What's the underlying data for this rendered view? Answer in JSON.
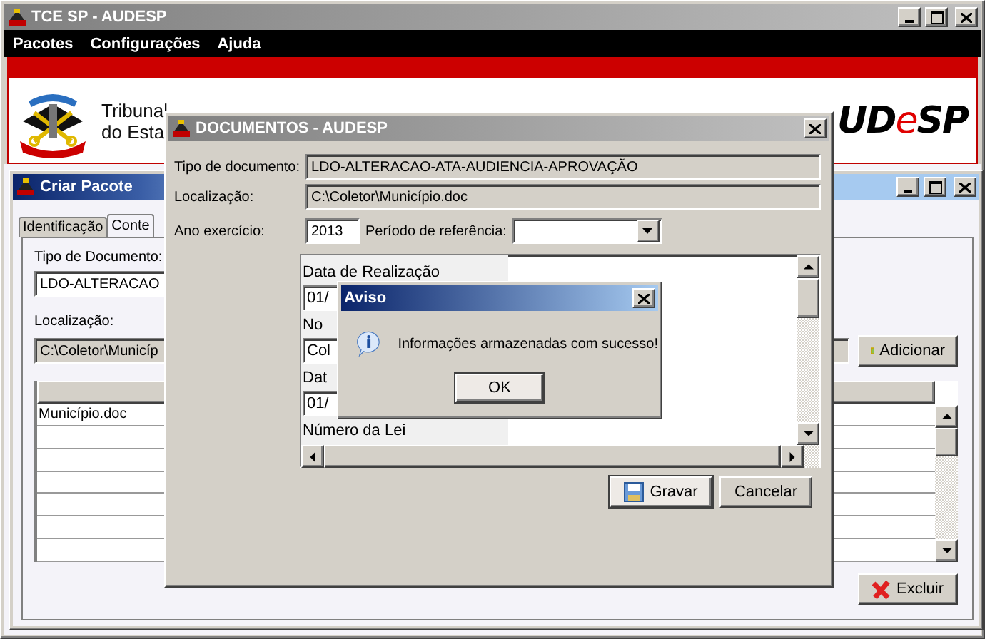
{
  "main_window": {
    "title": "TCE SP - AUDESP",
    "menu": [
      "Pacotes",
      "Configurações",
      "Ajuda"
    ],
    "banner_lines": [
      "Tribunal",
      "do Esta"
    ],
    "logo_parts": [
      "UD",
      "e",
      "SP"
    ]
  },
  "criar_pacote": {
    "title": "Criar Pacote",
    "tabs": [
      {
        "label": "Identificação",
        "selected": false
      },
      {
        "label": "Conte",
        "selected": true
      }
    ],
    "fields": [
      {
        "label": "Tipo de Documento:",
        "value": "LDO-ALTERACAO",
        "disabled": false
      },
      {
        "label": "Localização:",
        "value": "C:\\Coletor\\Municíp",
        "disabled": true
      }
    ],
    "rows": [
      "Município.doc"
    ],
    "buttons": [
      {
        "label": "Adicionar",
        "kind": "add"
      },
      {
        "label": "Excluir",
        "kind": "delete"
      }
    ]
  },
  "documentos": {
    "title": "DOCUMENTOS - AUDESP",
    "fields": [
      {
        "label": "Tipo de documento:",
        "value": "LDO-ALTERACAO-ATA-AUDIENCIA-APROVAÇÃO",
        "disabled": true
      },
      {
        "label": "Localização:",
        "value": "C:\\Coletor\\Município.doc",
        "disabled": true
      }
    ],
    "year": {
      "label": "Ano exercício:",
      "value": "2013"
    },
    "period": {
      "label": "Período de referência:"
    },
    "form": [
      {
        "label": "Data de Realização",
        "value": "01/"
      },
      {
        "label": "No",
        "value": "Col"
      },
      {
        "label": "Dat",
        "value": "01/"
      },
      {
        "label": "Número da Lei"
      }
    ],
    "buttons": [
      {
        "label": "Gravar",
        "kind": "save",
        "focused": true
      },
      {
        "label": "Cancelar",
        "kind": "plain",
        "focused": false
      }
    ]
  },
  "aviso": {
    "title": "Aviso",
    "message": "Informações armazenadas com sucesso!",
    "button": "OK"
  }
}
